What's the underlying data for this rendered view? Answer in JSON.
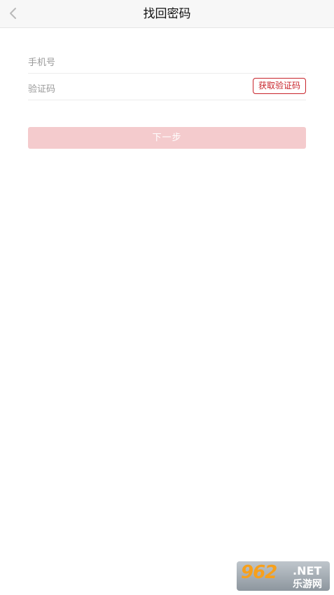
{
  "header": {
    "title": "找回密码",
    "back_icon": "chevron-left-icon"
  },
  "form": {
    "phone_placeholder": "手机号",
    "phone_value": "",
    "code_placeholder": "验证码",
    "code_value": "",
    "get_code_label": "获取验证码"
  },
  "next_button_label": "下一步",
  "watermark": {
    "number": "962",
    "domain": ".NET",
    "name": "乐游网"
  },
  "colors": {
    "accent": "#c8242b",
    "disabled_button": "#f4cbcd",
    "nav_background": "#f7f7f7"
  }
}
